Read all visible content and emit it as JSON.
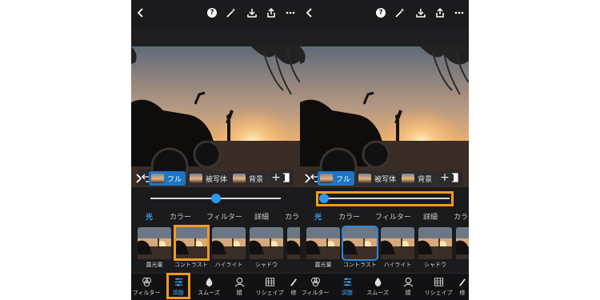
{
  "colors": {
    "accent": "#2b9be8",
    "highlight": "#f39a1e",
    "background": "#1b1b1d",
    "active_tab": "#1e74c6"
  },
  "icons": [
    "back-icon",
    "help-icon",
    "magic-wand-icon",
    "download-icon",
    "share-icon",
    "more-icon",
    "undo-icon",
    "compare-icon",
    "chevron-right-icon",
    "plus-icon",
    "filter-icon",
    "adjust-icon",
    "smooth-icon",
    "face-icon",
    "reshape-icon"
  ],
  "left": {
    "help_glyph": "?",
    "masks": {
      "full": "フル",
      "subject": "被写体",
      "background": "背景",
      "add": "+"
    },
    "slider_level": 0.5,
    "categories": [
      "光",
      "カラー",
      "フィルター",
      "詳細",
      "カラ"
    ],
    "presets": [
      "露光量",
      "コントラスト",
      "ハイライト",
      "シャドウ",
      "ホ"
    ],
    "nav": [
      "フィルター",
      "調整",
      "スムーズ",
      "顔",
      "リシェイプ",
      "修"
    ]
  },
  "right": {
    "help_glyph": "?",
    "masks": {
      "full": "フル",
      "subject": "被写体",
      "background": "背景",
      "add": "+"
    },
    "slider_level": 0.0,
    "categories": [
      "光",
      "カラー",
      "フィルター",
      "詳細",
      "カラ"
    ],
    "presets": [
      "露光量",
      "コントラスト",
      "ハイライト",
      "シャドウ",
      "ホ"
    ],
    "nav": [
      "フィルター",
      "調整",
      "スムーズ",
      "顔",
      "リシェイプ",
      "修"
    ]
  }
}
